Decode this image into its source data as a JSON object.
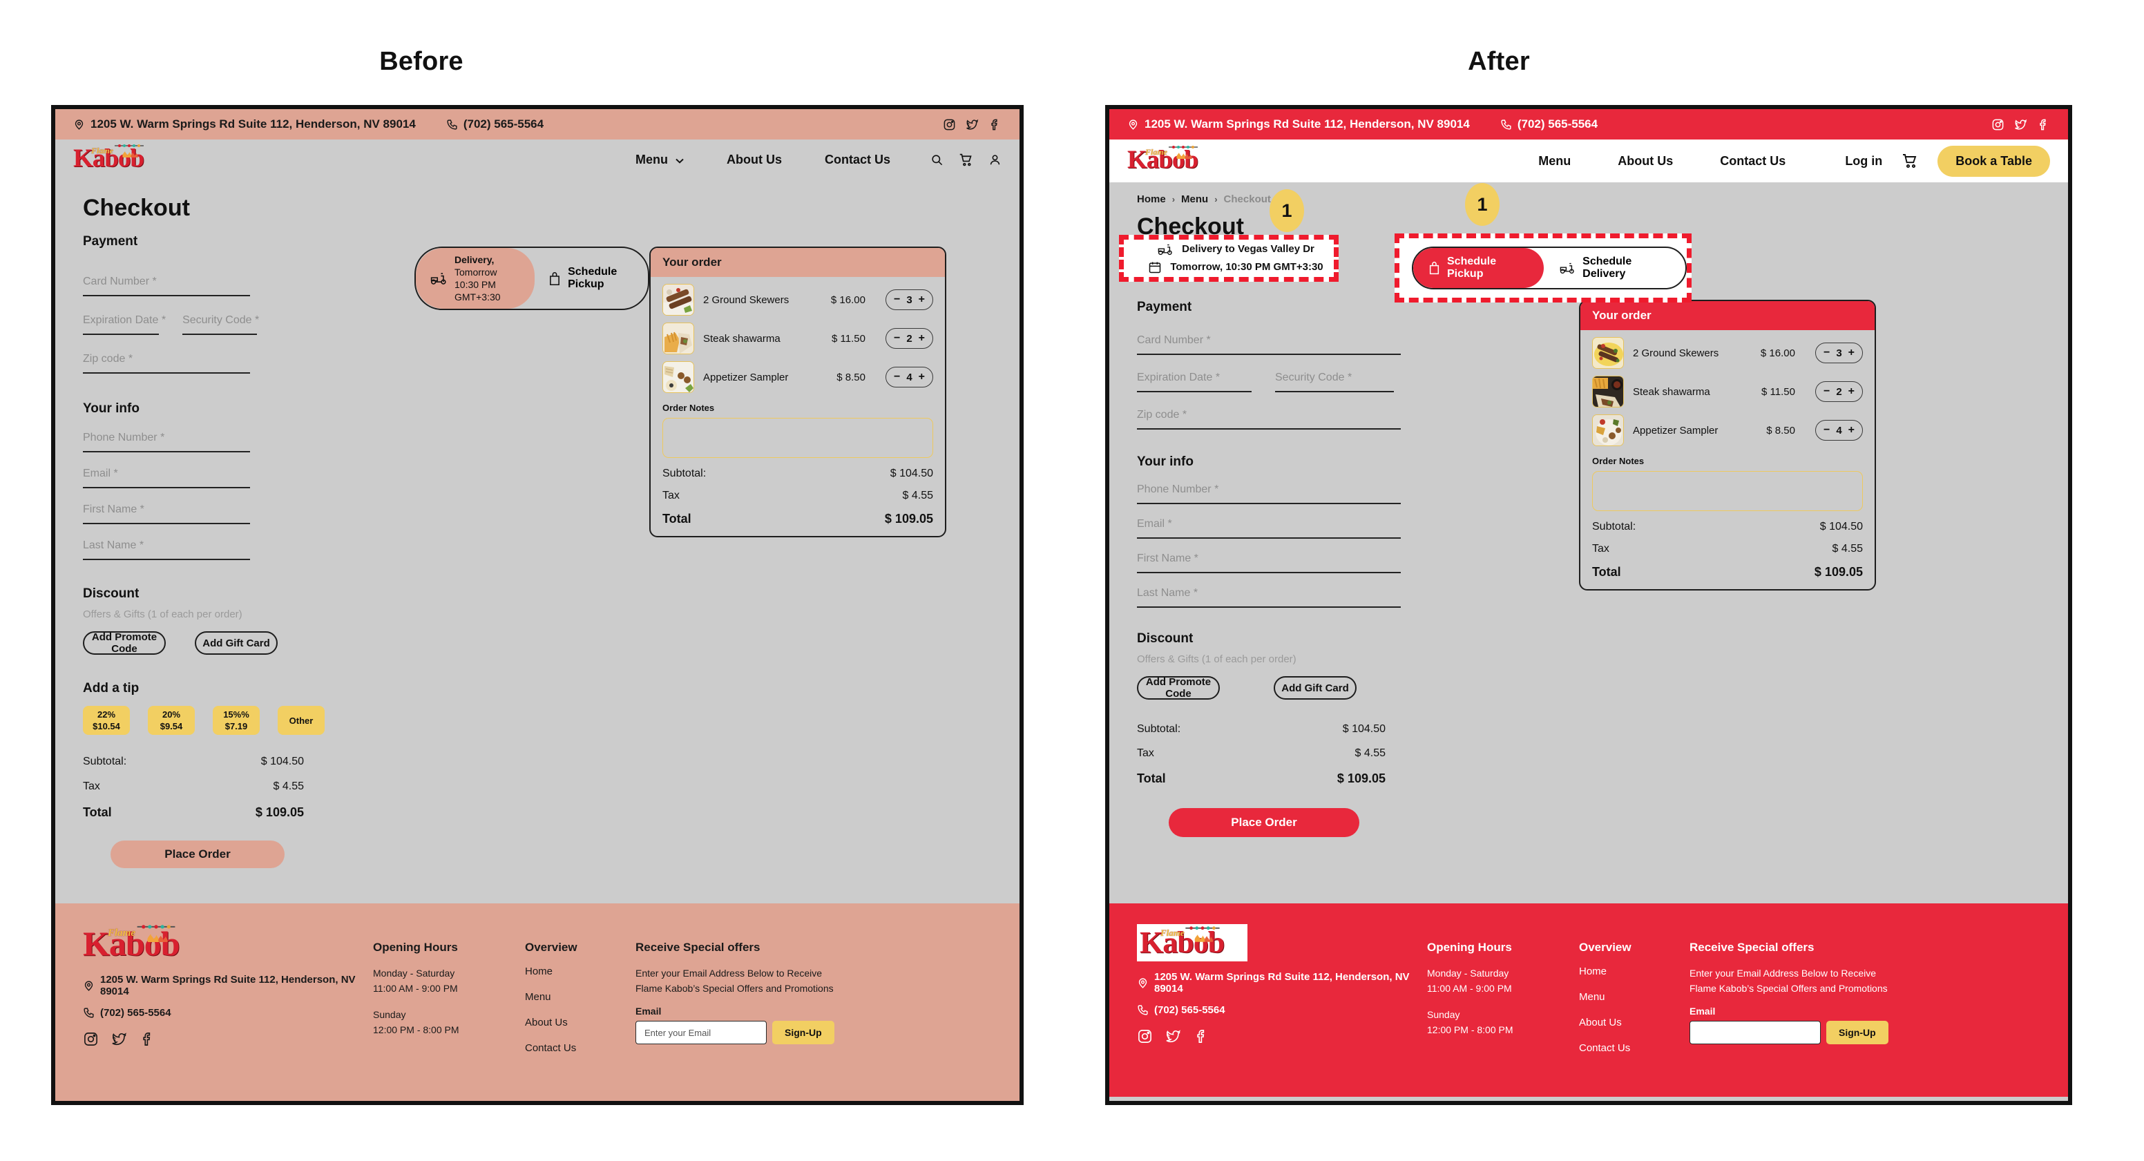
{
  "captions": {
    "before": "Before",
    "after": "After"
  },
  "topbar": {
    "address": "1205 W. Warm Springs Rd Suite 112, Henderson, NV 89014",
    "phone": "(702) 565-5564",
    "socials": [
      "instagram-icon",
      "twitter-icon",
      "facebook-icon"
    ]
  },
  "logo": {
    "word": "Kabob",
    "flame": "Flame"
  },
  "nav_before": {
    "links": [
      "Menu",
      "About Us",
      "Contact Us"
    ],
    "menu_has_caret": true,
    "icons": [
      "search-icon",
      "cart-icon",
      "account-icon"
    ]
  },
  "nav_after": {
    "links": [
      "Menu",
      "About Us",
      "Contact Us"
    ],
    "login": "Log in",
    "cart": "cart-icon",
    "book_table": "Book a Table"
  },
  "breadcrumb": {
    "home": "Home",
    "menu": "Menu",
    "current": "Checkout",
    "separator": "›"
  },
  "page": {
    "title": "Checkout"
  },
  "fulfillment_before": {
    "delivery_title": "Delivery,",
    "delivery_when": "Tomorrow",
    "delivery_time": "10:30 PM GMT+3:30",
    "pickup_label": "Schedule Pickup"
  },
  "fulfillment_after": {
    "address_line": "Delivery to Vegas Valley Dr",
    "time_line": "Tomorrow, 10:30 PM GMT+3:30",
    "pickup_label": "Schedule Pickup",
    "delivery_label": "Schedule Delivery"
  },
  "annotations": {
    "badge_left": "1",
    "badge_right": "1"
  },
  "payment": {
    "heading": "Payment",
    "fields": [
      "Card Number *",
      "Expiration Date *",
      "Security Code *",
      "Zip code *"
    ]
  },
  "your_info": {
    "heading": "Your info",
    "fields": [
      "Phone Number *",
      "Email *",
      "First Name *",
      "Last Name *"
    ]
  },
  "discount": {
    "heading": "Discount",
    "subtitle": "Offers & Gifts (1 of each per order)",
    "promote_code": "Add Promote Code",
    "gift_card": "Add Gift Card"
  },
  "tip": {
    "heading": "Add a tip",
    "options": [
      {
        "pct": "22%",
        "amount": "$10.54"
      },
      {
        "pct": "20%",
        "amount": "$9.54"
      },
      {
        "pct": "15%%",
        "amount": "$7.19"
      },
      {
        "pct": "Other",
        "amount": ""
      }
    ]
  },
  "totals": {
    "subtotal_label": "Subtotal:",
    "subtotal_value": "$ 104.50",
    "tax_label": "Tax",
    "tax_value": "$ 4.55",
    "total_label": "Total",
    "total_value": "$ 109.05"
  },
  "place_order": "Place Order",
  "order": {
    "heading": "Your order",
    "notes_label": "Order Notes",
    "items": [
      {
        "name": "2 Ground Skewers",
        "price": "$ 16.00",
        "qty": "3"
      },
      {
        "name": "Steak shawarma",
        "price": "$ 11.50",
        "qty": "2"
      },
      {
        "name": "Appetizer Sampler",
        "price": "$ 8.50",
        "qty": "4"
      }
    ]
  },
  "footer": {
    "address": "1205 W. Warm Springs Rd Suite 112, Henderson, NV 89014",
    "phone": "(702) 565-5564",
    "hours_heading": "Opening Hours",
    "hours_weekday_days": "Monday - Saturday",
    "hours_weekday_time": "11:00 AM - 9:00 PM",
    "hours_sunday_days": "Sunday",
    "hours_sunday_time": "12:00 PM - 8:00 PM",
    "overview_heading": "Overview",
    "overview_links": [
      "Home",
      "Menu",
      "About Us",
      "Contact Us"
    ],
    "offers_heading": "Receive Special offers",
    "offers_text": "Enter your Email Address Below to Receive Flame Kabob’s Special Offers and Promotions",
    "email_label": "Email",
    "email_placeholder": "Enter your Email",
    "signup": "Sign-Up"
  },
  "colors": {
    "before_accent": "#dea493",
    "after_accent": "#e8283c",
    "yellow": "#f2cf62",
    "page_bg": "#cccccc",
    "annotation_red": "#ef1b2d"
  }
}
